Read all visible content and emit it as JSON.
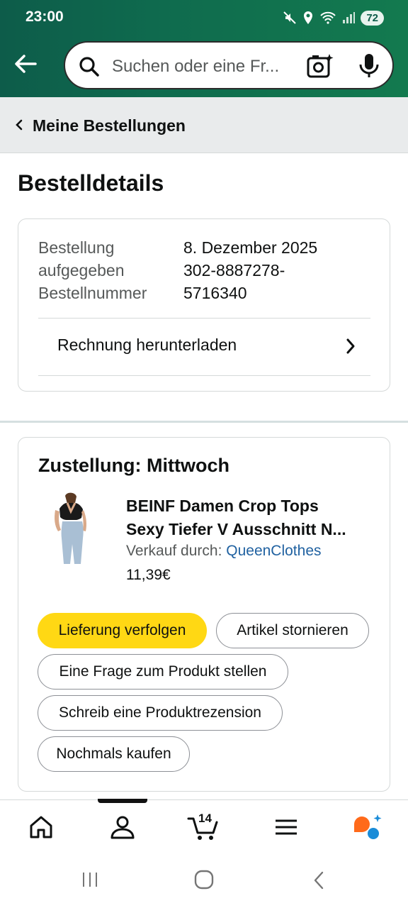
{
  "status_bar": {
    "time": "23:00",
    "battery": "72"
  },
  "search": {
    "placeholder": "Suchen oder eine Fr..."
  },
  "breadcrumb": {
    "label": "Meine Bestellungen"
  },
  "page": {
    "title": "Bestelldetails"
  },
  "order_details": {
    "label_line1": "Bestellung",
    "label_line2": "aufgegeben",
    "label_line3": "Bestellnummer",
    "date": "8. Dezember 2025",
    "number_line1": "302-8887278-",
    "number_line2": "5716340",
    "invoice_label": "Rechnung herunterladen"
  },
  "delivery": {
    "title": "Zustellung: Mittwoch",
    "product_title_line1": "BEINF Damen Crop Tops",
    "product_title_line2": "Sexy Tiefer V Ausschnitt N...",
    "seller_prefix": "Verkauf durch: ",
    "seller_name": "QueenClothes",
    "price": "11,39€"
  },
  "actions": {
    "track": "Lieferung verfolgen",
    "cancel": "Artikel stornieren",
    "question": "Eine Frage zum Produkt stellen",
    "review": "Schreib eine Produktrezension",
    "buy_again": "Nochmals kaufen"
  },
  "bottom_nav": {
    "cart_count": "14"
  },
  "colors": {
    "header_green": "#0f6b4e",
    "primary_button": "#ffd814",
    "link": "#2162a1"
  }
}
